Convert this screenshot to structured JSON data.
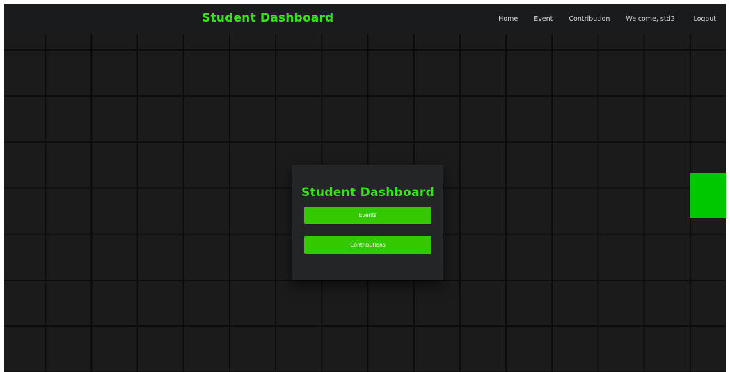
{
  "navbar": {
    "brand": "Student Dashboard",
    "links": {
      "home": "Home",
      "event": "Event",
      "contribution": "Contribution",
      "welcome": "Welcome, std2!",
      "logout": "Logout"
    }
  },
  "card": {
    "title": "Student Dashboard",
    "events_button": "Events",
    "contributions_button": "Contributions"
  },
  "colors": {
    "accent_green": "#39e21d",
    "button_green": "#33c800",
    "highlight_cell": "#00c800",
    "background": "#111111",
    "navbar": "#1a1b1c",
    "card": "#232527"
  }
}
